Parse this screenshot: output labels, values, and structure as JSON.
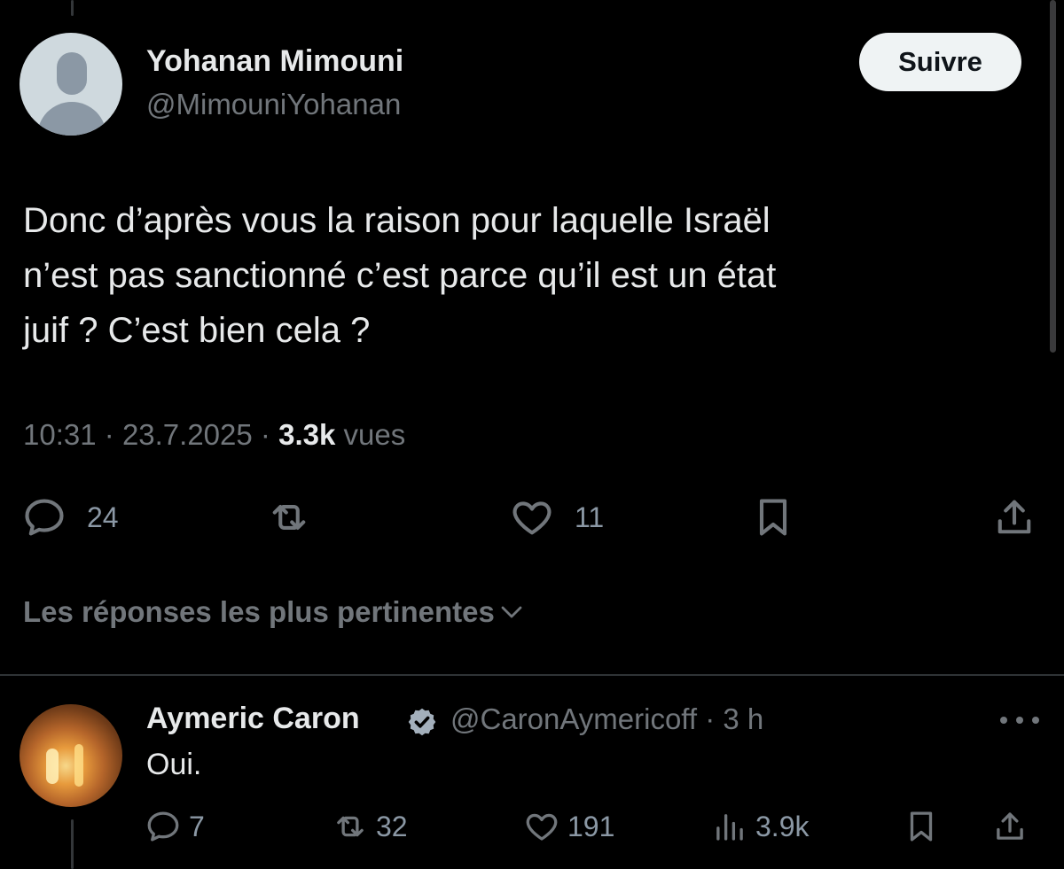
{
  "tweet": {
    "author_name": "Yohanan Mimouni",
    "author_handle": "@MimouniYohanan",
    "follow_label": "Suivre",
    "text_lines": [
      "Donc d’après vous la raison pour laquelle Israël",
      "n’est pas sanctionné c’est parce qu’il est un état",
      "juif ? C’est bien cela ?"
    ],
    "time": "10:31",
    "date": "23.7.2025",
    "views_count": "3.3k",
    "views_label": "vues",
    "separator": "·",
    "replies": "24",
    "retweets": "",
    "likes": "11"
  },
  "sort": {
    "label": "Les réponses les plus pertinentes"
  },
  "reply": {
    "author_name": "Aymeric Caron",
    "author_handle": "@CaronAymericoff",
    "separator": "·",
    "age": "3 h",
    "text": "Oui.",
    "replies": "7",
    "retweets": "32",
    "likes": "191",
    "views": "3.9k"
  },
  "icons": {
    "verified_color": "#a3afbb",
    "icon_color": "#71767b"
  }
}
